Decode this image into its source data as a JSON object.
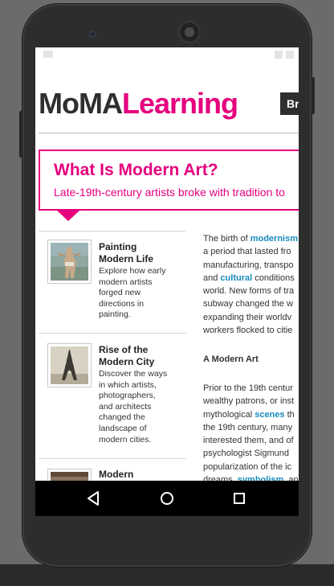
{
  "logo": {
    "part1": "MoMA",
    "part2": "Learning"
  },
  "header": {
    "browse_label": "Br"
  },
  "hero": {
    "title": "What Is Modern Art?",
    "subtitle": "Late-19th-century artists broke with tradition to"
  },
  "sidebar": {
    "items": [
      {
        "title_line1": "Painting",
        "title_line2": "Modern Life",
        "desc": [
          "Explore how early",
          "modern artists",
          "forged new",
          "directions in",
          "painting."
        ]
      },
      {
        "title_line1": "Rise of the",
        "title_line2": "Modern City",
        "desc": [
          "Discover the ways",
          "in which artists,",
          "photographers,",
          "and architects",
          "changed the",
          "landscape of",
          "modern cities."
        ]
      },
      {
        "title_line1": "Modern",
        "title_line2": "",
        "desc": []
      }
    ]
  },
  "article": {
    "p1": {
      "l1a": "The birth of ",
      "l1kw": "modernism",
      "l2": "a period that lasted fro",
      "l3": "manufacturing, transpo",
      "l4a": "and ",
      "l4kw": "cultural",
      "l4b": " conditions",
      "l5": "world. New forms of tra",
      "l6": "subway changed the w",
      "l7": "expanding their worldv",
      "l8": "workers flocked to citie"
    },
    "heading": "A Modern Art",
    "p2": {
      "l1": "Prior to the 19th centur",
      "l2": "wealthy patrons, or inst",
      "l3a": "mythological ",
      "l3kw": "scenes",
      "l3b": " th",
      "l4": "the 19th century, many",
      "l5": "interested them, and of",
      "l6": "psychologist Sigmund",
      "l7": "popularization of the ic",
      "l8a": "dreams, ",
      "l8kw": "symbolism",
      "l8b": ", an"
    }
  },
  "colors": {
    "brand": "#e5007e",
    "link": "#1a8bbf",
    "text": "#333333"
  }
}
